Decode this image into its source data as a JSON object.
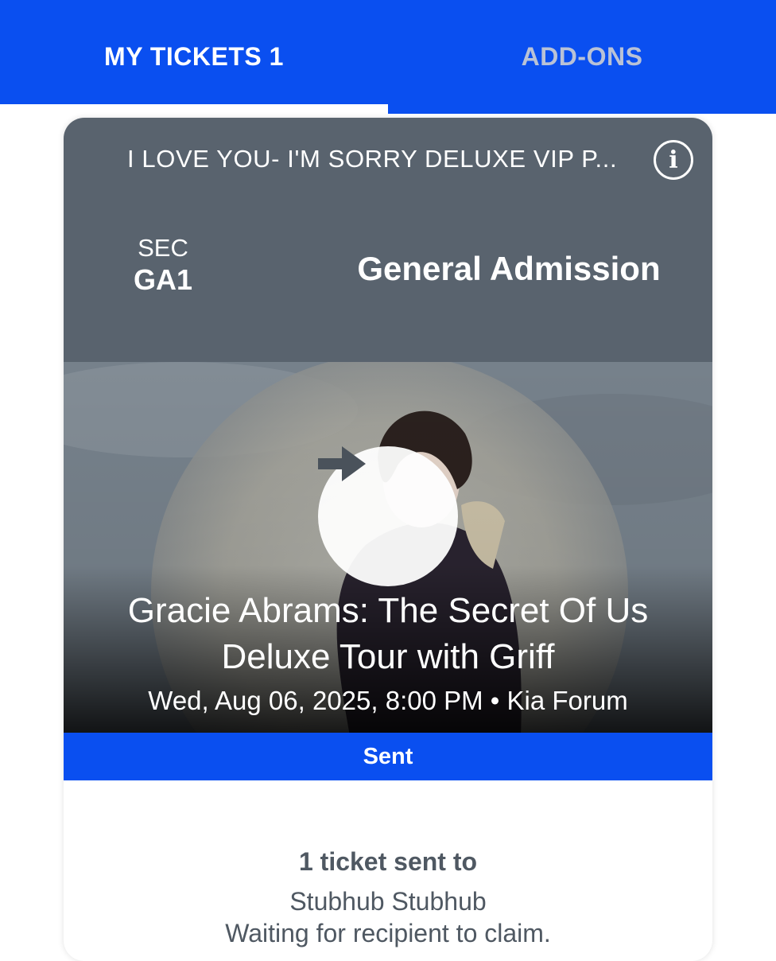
{
  "tabs": {
    "my_tickets": "MY TICKETS 1",
    "add_ons": "ADD-ONS"
  },
  "ticket": {
    "type_label": "I LOVE YOU- I'M SORRY DELUXE VIP P...",
    "info_icon": "info-icon",
    "section_label": "SEC",
    "section_value": "GA1",
    "admission": "General Admission"
  },
  "event": {
    "title": "Gracie Abrams: The Secret Of Us Deluxe Tour with Griff",
    "meta": "Wed, Aug 06, 2025, 8:00 PM • Kia Forum",
    "play_icon": "arrow-right-icon"
  },
  "status": {
    "label": "Sent"
  },
  "transfer": {
    "heading": "1 ticket sent to",
    "recipient": "Stubhub Stubhub",
    "status": "Waiting for recipient to claim."
  },
  "colors": {
    "brand_blue": "#0a4ff0",
    "card_header": "#59636e",
    "inactive_tab_text": "#b9c2d6",
    "body_text": "#4f5862"
  }
}
